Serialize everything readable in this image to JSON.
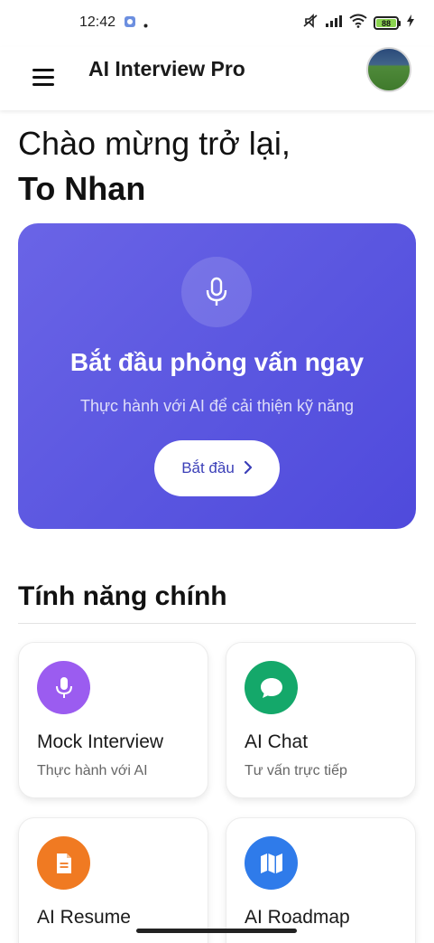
{
  "status_bar": {
    "time": "12:42",
    "battery": "88",
    "icons": [
      "notification-icon",
      "mute-icon",
      "signal-icon",
      "wifi-icon",
      "battery-icon",
      "charging-icon"
    ]
  },
  "app_bar": {
    "title": "AI Interview Pro",
    "menu_icon": "hamburger-menu-icon",
    "avatar": "user-avatar"
  },
  "greeting": {
    "welcome": "Chào mừng trở lại,",
    "name": "To Nhan"
  },
  "hero": {
    "icon": "microphone-icon",
    "title": "Bắt đầu phỏng vấn ngay",
    "subtitle": "Thực hành với AI để cải thiện kỹ năng",
    "button_label": "Bắt đầu",
    "button_icon": "chevron-right-icon",
    "gradient_start": "#6a64e6",
    "gradient_end": "#4f4adc"
  },
  "features": {
    "title": "Tính năng chính",
    "items": [
      {
        "title": "Mock Interview",
        "subtitle": "Thực hành với AI",
        "icon": "microphone-icon",
        "color": "#9b5cf0"
      },
      {
        "title": "AI Chat",
        "subtitle": "Tư vấn trực tiếp",
        "icon": "chat-bubble-icon",
        "color": "#14a86a"
      },
      {
        "title": "AI Resume",
        "subtitle": "",
        "icon": "document-icon",
        "color": "#f07a22"
      },
      {
        "title": "AI Roadmap",
        "subtitle": "",
        "icon": "map-icon",
        "color": "#2f7bea"
      }
    ]
  }
}
